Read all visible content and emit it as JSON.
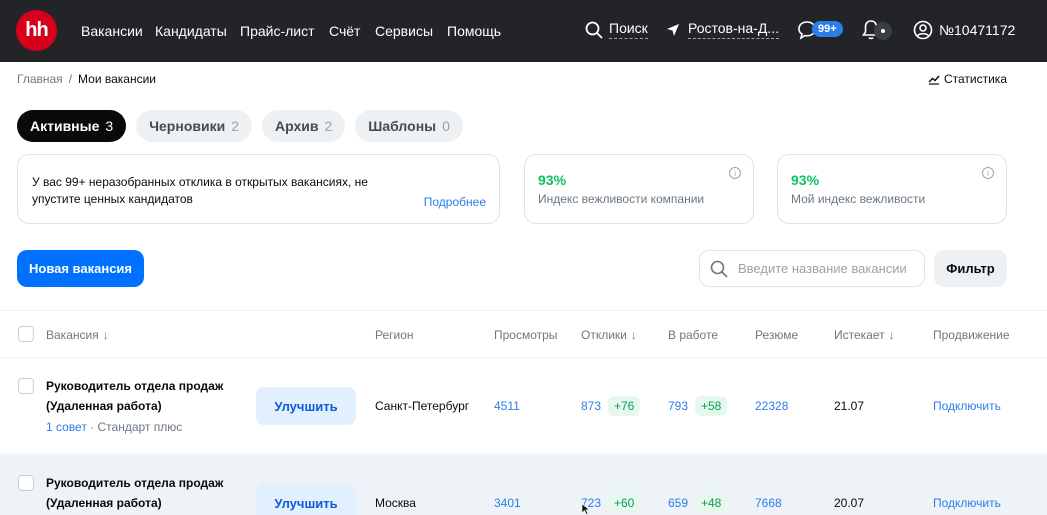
{
  "nav": {
    "logo": "hh",
    "links": [
      "Вакансии",
      "Кандидаты",
      "Прайс-лист",
      "Счёт",
      "Сервисы",
      "Помощь"
    ],
    "search_label": "Поиск",
    "geo_label": "Ростов-на-Д...",
    "messages_badge": "99+",
    "account": "№10471172"
  },
  "breadcrumb": {
    "home": "Главная",
    "separator": "/",
    "current": "Мои вакансии"
  },
  "stats_label": "Статистика",
  "tabs": [
    {
      "label": "Активные",
      "count": "3",
      "active": true
    },
    {
      "label": "Черновики",
      "count": "2",
      "active": false
    },
    {
      "label": "Архив",
      "count": "2",
      "active": false
    },
    {
      "label": "Шаблоны",
      "count": "0",
      "active": false
    }
  ],
  "notice": {
    "text": "У вас 99+ неразобранных отклика в открытых вакансиях, не упустите ценных кандидатов",
    "link": "Подробнее"
  },
  "politeness_company": {
    "value": "93%",
    "label": "Индекс вежливости компании"
  },
  "politeness_mine": {
    "value": "93%",
    "label": "Мой индекс вежливости"
  },
  "new_vacancy_label": "Новая вакансия",
  "search": {
    "placeholder": "Введите название вакансии",
    "value": ""
  },
  "filter_label": "Фильтр",
  "table": {
    "headers": {
      "vacancy": "Вакансия",
      "region": "Регион",
      "views": "Просмотры",
      "responses": "Отклики",
      "in_work": "В работе",
      "resumes": "Резюме",
      "expires": "Истекает",
      "promotion": "Продвижение"
    },
    "rows": [
      {
        "title": "Руководитель отдела продаж (Удаленная работа)",
        "tip_link": "1 совет",
        "plan": "· Стандарт плюс",
        "improve": "Улучшить",
        "region": "Санкт-Петербург",
        "views": "4511",
        "responses": "873",
        "responses_delta": "+76",
        "in_work": "793",
        "in_work_delta": "+58",
        "resumes": "22328",
        "expires": "21.07",
        "promotion": "Подключить"
      },
      {
        "title": "Руководитель отдела продаж (Удаленная работа)",
        "improve": "Улучшить",
        "region": "Москва",
        "views": "3401",
        "responses": "723",
        "responses_delta": "+60",
        "in_work": "659",
        "in_work_delta": "+48",
        "resumes": "7668",
        "expires": "20.07",
        "promotion": "Подключить"
      }
    ]
  }
}
